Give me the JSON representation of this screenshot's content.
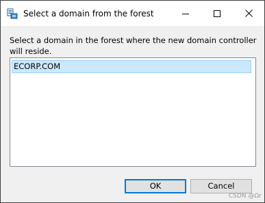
{
  "window": {
    "title": "Select a domain from the forest",
    "title_icon": "domain-forest-icon",
    "controls": {
      "minimize_icon": "minimize-icon",
      "maximize_icon": "maximize-icon",
      "close_icon": "close-icon"
    }
  },
  "dialog": {
    "instruction": "Select a domain in the forest where the new domain controller will reside.",
    "domains": [
      {
        "label": "ECORP.COM",
        "selected": true
      }
    ]
  },
  "buttons": {
    "ok_label": "OK",
    "cancel_label": "Cancel"
  },
  "watermark": "CSDN @Ωr",
  "colors": {
    "selection_fill": "#cce8ff",
    "selection_border": "#99d1ff",
    "default_button_border": "#0078d7"
  }
}
